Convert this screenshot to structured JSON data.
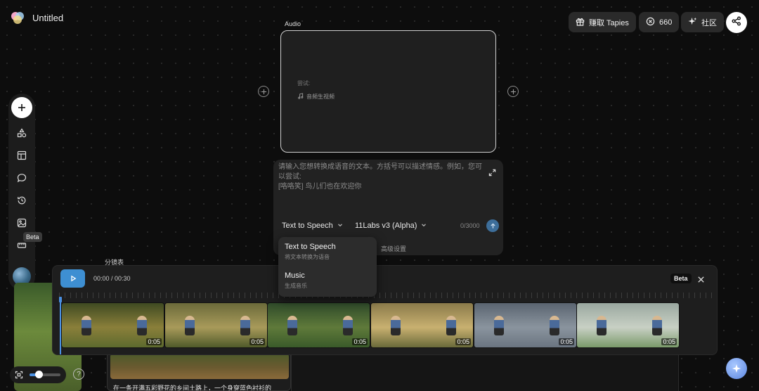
{
  "header": {
    "title": "Untitled",
    "earn_label": "赚取 Tapies",
    "credits": "660",
    "community_label": "社区"
  },
  "toolbar": {
    "beta_tooltip": "Beta"
  },
  "audio_node": {
    "label": "Audio",
    "try_label": "尝试:",
    "try_item": "音频生视频"
  },
  "prompt": {
    "placeholder": "请输入您想转换成语音的文本。方括号可以描述情感。例如，您可以尝试:\n[咯咯笑] 鸟儿们也在欢迎你",
    "mode": "Text to Speech",
    "model": "11Labs v3 (Alpha)",
    "char_count": "0/3000",
    "advanced_settings": "高级设置"
  },
  "mode_dropdown": {
    "options": [
      {
        "title": "Text to Speech",
        "subtitle": "将文本转换为语音"
      },
      {
        "title": "Music",
        "subtitle": "生成音乐"
      }
    ]
  },
  "storyboard": {
    "label": "分镜表",
    "card_text": "在一条开满五彩野花的乡间土路上，一个身穿蓝色衬衫的"
  },
  "timeline": {
    "time": "00:00 / 00:30",
    "beta_badge": "Beta",
    "clips": [
      {
        "duration": "0:05"
      },
      {
        "duration": "0:05"
      },
      {
        "duration": "0:05"
      },
      {
        "duration": "0:05"
      },
      {
        "duration": "0:05"
      },
      {
        "duration": "0:05"
      }
    ]
  },
  "zoom": {
    "level": 0.3
  },
  "colors": {
    "accent": "#3e8fd2",
    "background": "#0d0d0d",
    "panel": "#1e1e1e"
  }
}
